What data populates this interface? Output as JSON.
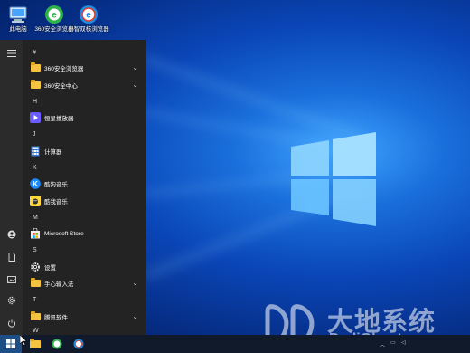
{
  "desktop": {
    "icons": [
      {
        "label": "此电脑",
        "icon": "computer-icon"
      },
      {
        "label": "360安全浏览器",
        "icon": "360-browser-icon"
      },
      {
        "label": "小智双核浏览器",
        "icon": "xiaozhi-browser-icon"
      }
    ]
  },
  "start_menu": {
    "sections": {
      "hash": "#",
      "h": "H",
      "j": "J",
      "k": "K",
      "m": "M",
      "s": "S",
      "t": "T",
      "w": "W"
    },
    "apps": {
      "browser360": "360安全浏览器",
      "center360": "360安全中心",
      "hengxing": "恒星播放器",
      "calculator": "计算器",
      "kugou": "酷狗音乐",
      "kuwo": "酷我音乐",
      "store": "Microsoft Store",
      "settings": "设置",
      "ime": "手心输入法",
      "tencent": "腾讯软件"
    }
  },
  "watermark": {
    "title": "大地系统",
    "subtitle": "DadiGhost.com"
  },
  "colors": {
    "menu_bg": "#232323",
    "taskbar_bg": "#101a2a",
    "folder": "#f5c342"
  }
}
